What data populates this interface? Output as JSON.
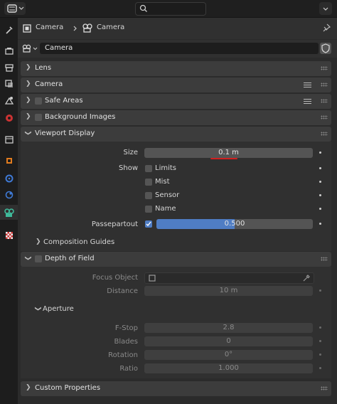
{
  "header": {
    "breadcrumb_object": "Camera",
    "breadcrumb_data": "Camera"
  },
  "datablock": {
    "name": "Camera"
  },
  "panels": {
    "lens": "Lens",
    "camera": "Camera",
    "safe_areas": "Safe Areas",
    "background_images": "Background Images",
    "viewport_display": "Viewport Display",
    "depth_of_field": "Depth of Field",
    "custom_properties": "Custom Properties"
  },
  "viewport_display": {
    "size_label": "Size",
    "size_value": "0.1 m",
    "show_label": "Show",
    "limits": "Limits",
    "mist": "Mist",
    "sensor": "Sensor",
    "name": "Name",
    "passepartout_label": "Passepartout",
    "passepartout_value": "0.500",
    "passepartout_fraction": 0.5,
    "composition_guides": "Composition Guides"
  },
  "dof": {
    "focus_object_label": "Focus Object",
    "distance_label": "Distance",
    "distance_value": "10 m",
    "aperture": "Aperture",
    "fstop_label": "F-Stop",
    "fstop_value": "2.8",
    "blades_label": "Blades",
    "blades_value": "0",
    "rotation_label": "Rotation",
    "rotation_value": "0°",
    "ratio_label": "Ratio",
    "ratio_value": "1.000"
  },
  "colors": {
    "accent": "#4f7dc4",
    "underline": "#d02020"
  },
  "icons": [
    "editor-type-icon",
    "search-icon",
    "tool-tab-icon",
    "render-tab-icon",
    "output-tab-icon",
    "view-layer-tab-icon",
    "scene-tab-icon",
    "world-tab-icon",
    "collection-tab-icon",
    "object-tab-icon",
    "modifier-tab-icon",
    "physics-tab-icon",
    "camera-data-tab-icon",
    "texture-tab-icon",
    "pin-icon",
    "shield-icon",
    "eyedropper-icon"
  ]
}
